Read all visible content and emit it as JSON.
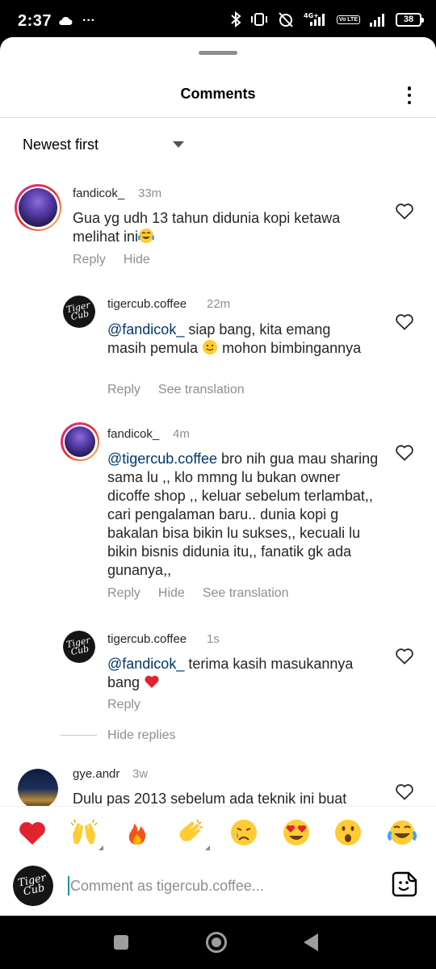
{
  "status_bar": {
    "time": "2:37",
    "more": "···",
    "network": "4G+",
    "volte": "Vo LTE",
    "battery": "38"
  },
  "sheet": {
    "title": "Comments",
    "sort_label": "Newest first"
  },
  "comments": [
    {
      "username": "fandicok_",
      "time": "33m",
      "text": "Gua yg udh 13 tahun didunia kopi ketawa melihat ini",
      "actions": [
        "Reply",
        "Hide"
      ]
    },
    {
      "username": "tigercub.coffee",
      "time": "22m",
      "mention": "@fandicok_",
      "text": " siap bang, kita emang masih pemula ",
      "text_after": " mohon bimbingannya",
      "actions": [
        "Reply",
        "See translation"
      ]
    },
    {
      "username": "fandicok_",
      "time": "4m",
      "mention": "@tigercub.coffee",
      "text": " bro nih gua mau sharing sama lu ,, klo mmng lu bukan owner dicoffe shop ,, keluar sebelum terlambat,, cari pengalaman baru.. dunia kopi g bakalan bisa bikin lu sukses,, kecuali lu bikin bisnis didunia itu,, fanatik gk ada gunanya,,",
      "actions": [
        "Reply",
        "Hide",
        "See translation"
      ]
    },
    {
      "username": "tigercub.coffee",
      "time": "1s",
      "mention": "@fandicok_",
      "text": " terima kasih masukannya bang ",
      "actions": [
        "Reply"
      ]
    },
    {
      "username": "gye.andr",
      "time": "3w",
      "text": "Dulu pas 2013 sebelum ada teknik ini buat"
    }
  ],
  "hide_replies": "Hide replies",
  "logo_text": "Tiger Cub",
  "emoji_bar": [
    "heart",
    "raised-hands",
    "fire",
    "clapping-hands",
    "crying-face",
    "heart-eyes",
    "surprised-face",
    "tears-of-joy"
  ],
  "compose": {
    "placeholder": "Comment as tigercub.coffee..."
  },
  "colors": {
    "mention": "#00376b",
    "secondary_text": "#8e8e8e",
    "heart": "#ed4956"
  }
}
